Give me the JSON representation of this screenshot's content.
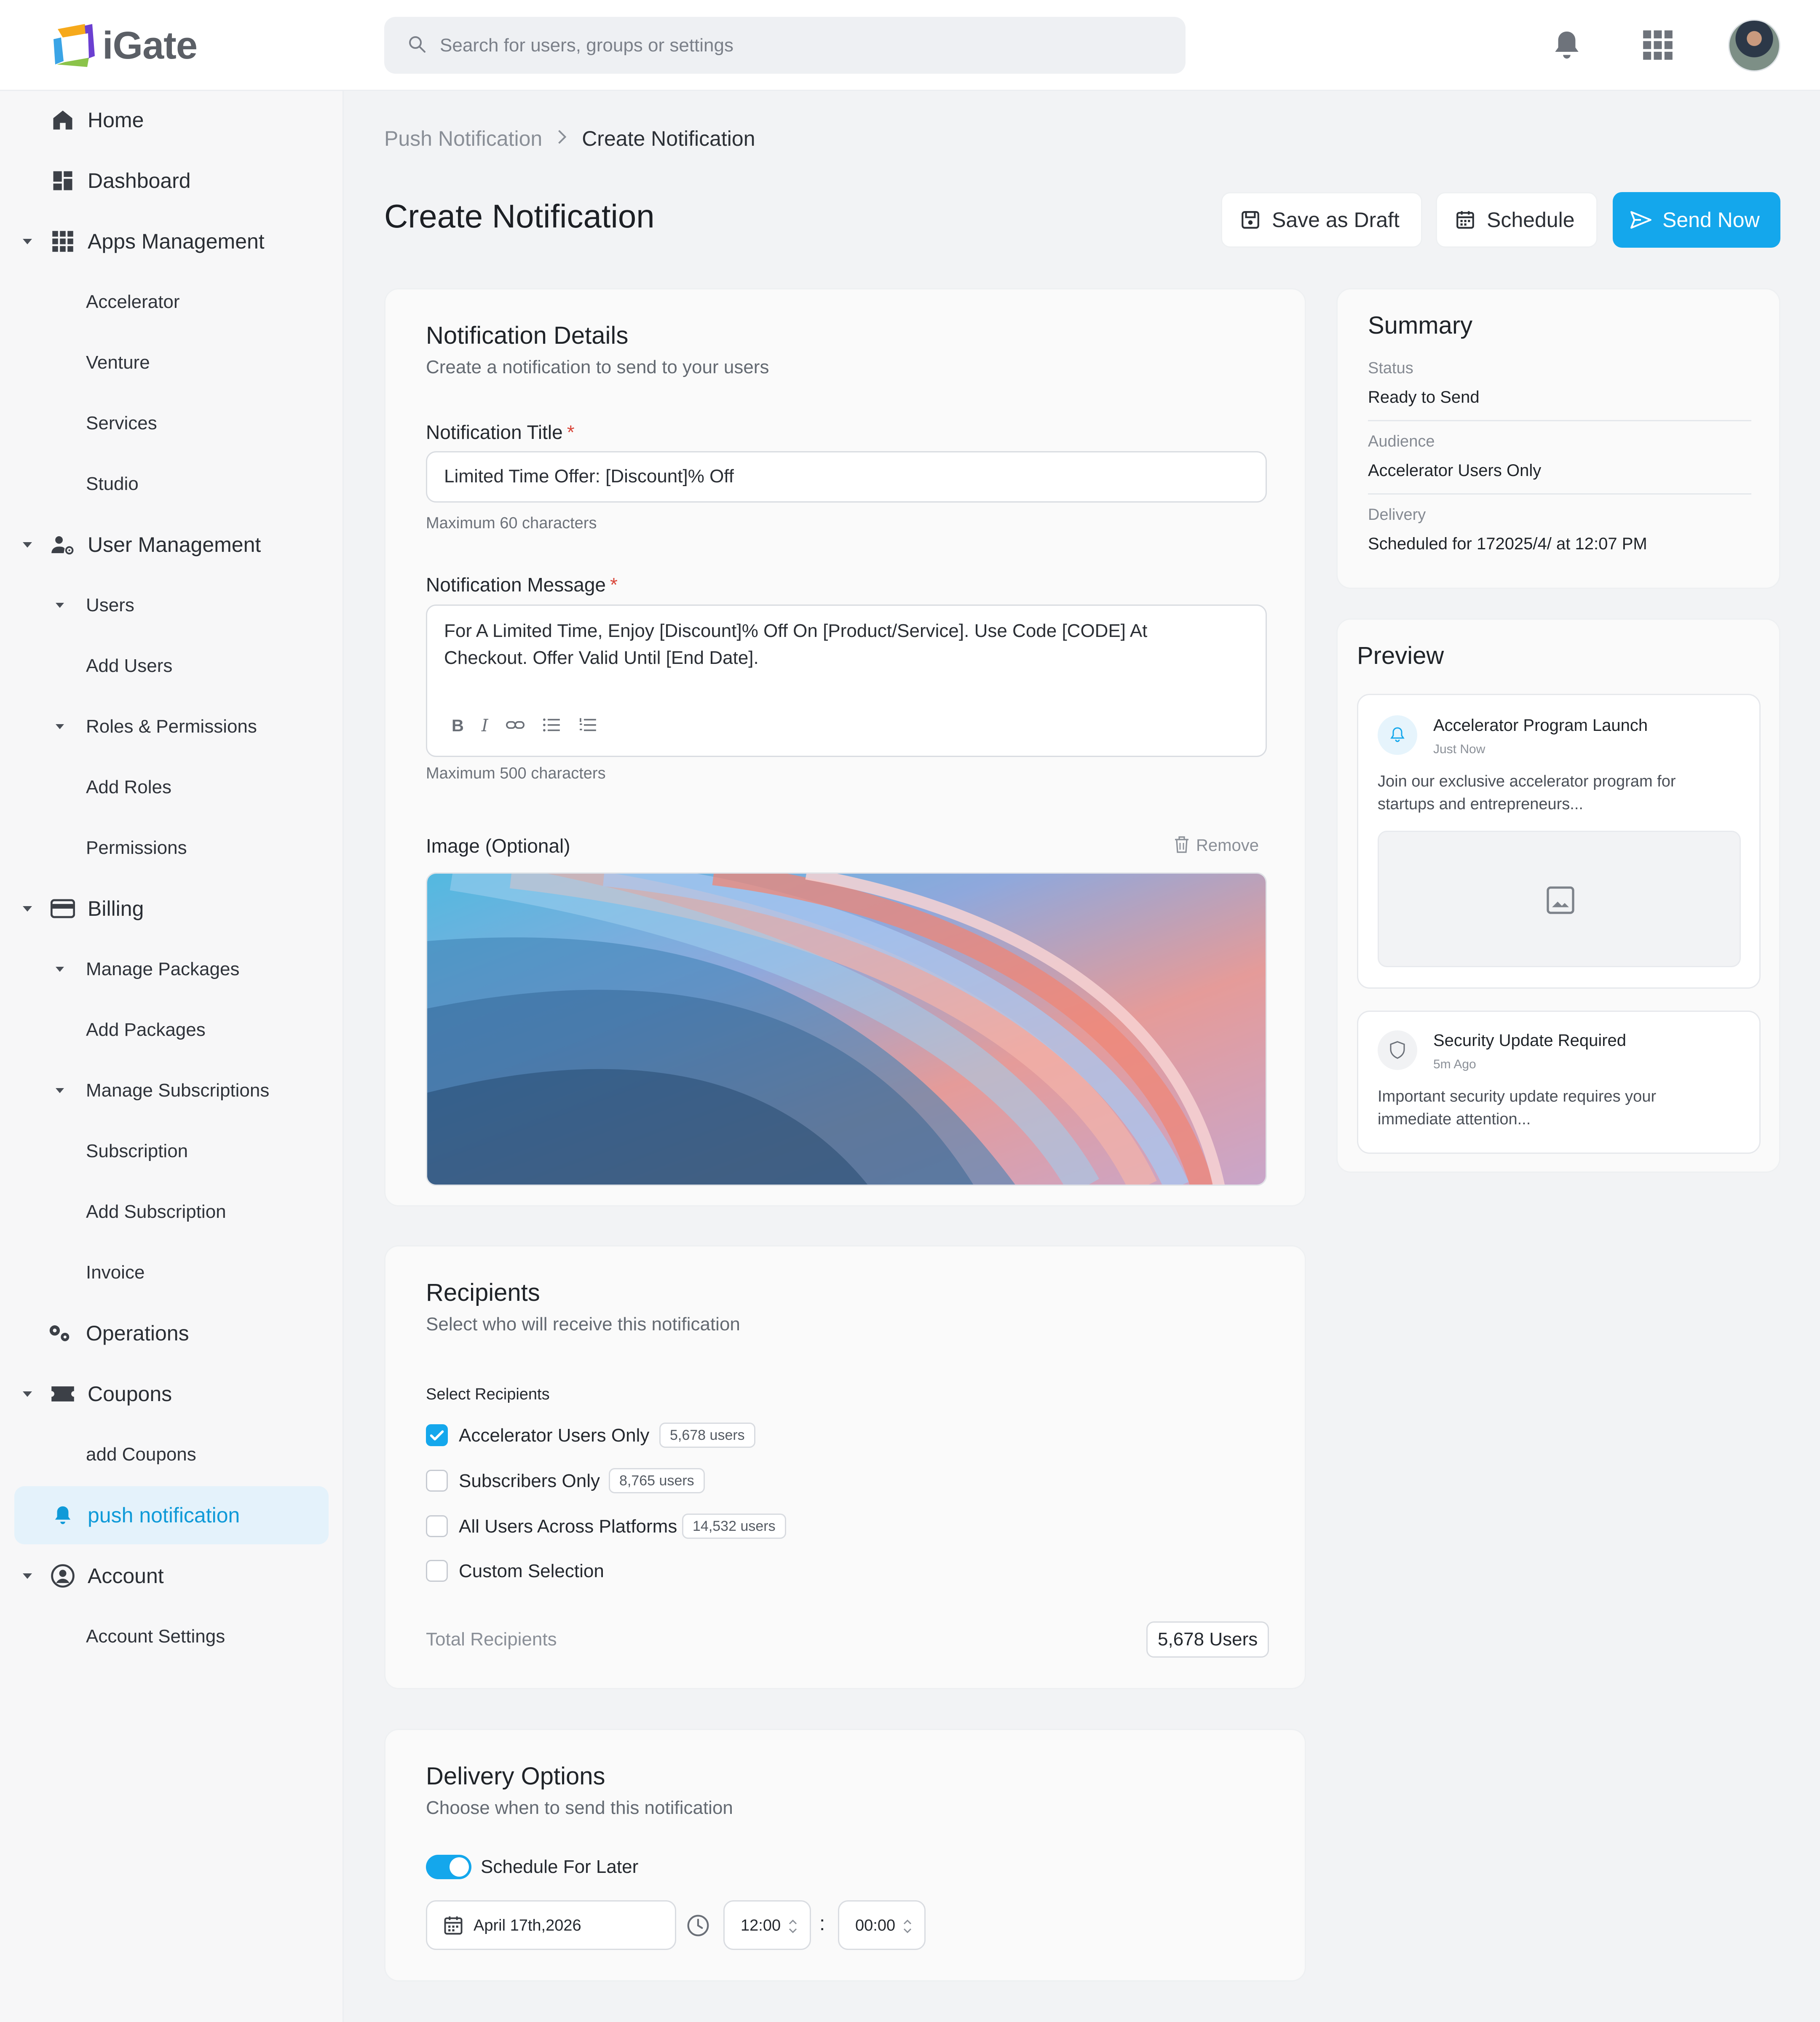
{
  "app": {
    "name": "iGate"
  },
  "search": {
    "placeholder": "Search for users, groups or settings"
  },
  "sidebar": {
    "items": [
      {
        "label": "Home"
      },
      {
        "label": "Dashboard"
      },
      {
        "label": "Apps Management"
      },
      {
        "label": "Accelerator"
      },
      {
        "label": "Venture"
      },
      {
        "label": "Services"
      },
      {
        "label": "Studio"
      },
      {
        "label": "User Management"
      },
      {
        "label": "Users"
      },
      {
        "label": "Add Users"
      },
      {
        "label": "Roles & Permissions"
      },
      {
        "label": "Add Roles"
      },
      {
        "label": "Permissions"
      },
      {
        "label": "Billing"
      },
      {
        "label": "Manage Packages"
      },
      {
        "label": "Add Packages"
      },
      {
        "label": "Manage Subscriptions"
      },
      {
        "label": "Subscription"
      },
      {
        "label": "Add Subscription"
      },
      {
        "label": "Invoice"
      },
      {
        "label": "Operations"
      },
      {
        "label": "Coupons"
      },
      {
        "label": "add Coupons"
      },
      {
        "label": "push notification"
      },
      {
        "label": "Account"
      },
      {
        "label": "Account Settings"
      }
    ],
    "active": "push notification"
  },
  "breadcrumb": {
    "parent": "Push Notification",
    "current": "Create Notification"
  },
  "header": {
    "title": "Create Notification",
    "save_draft": "Save as Draft",
    "schedule": "Schedule",
    "send_now": "Send Now"
  },
  "details": {
    "title": "Notification Details",
    "subtitle": "Create a notification to send to your users",
    "title_label": "Notification Title",
    "title_value": "Limited Time Offer: [Discount]% Off",
    "title_hint": "Maximum 60 characters",
    "message_label": "Notification Message",
    "message_line1": "For A Limited Time, Enjoy [Discount]% Off On [Product/Service]. Use Code [CODE] At",
    "message_line2": "Checkout. Offer Valid Until [End Date].",
    "message_hint": "Maximum 500 characters",
    "image_label": "Image (Optional)",
    "remove": "Remove",
    "required_mark": "*"
  },
  "recipients": {
    "title": "Recipients",
    "subtitle": "Select who will receive this notification",
    "select_label": "Select Recipients",
    "options": [
      {
        "label": "Accelerator Users Only",
        "count": "5,678 users",
        "checked": true
      },
      {
        "label": "Subscribers Only",
        "count": "8,765 users",
        "checked": false
      },
      {
        "label": "All Users Across Platforms",
        "count": "14,532 users",
        "checked": false
      },
      {
        "label": "Custom Selection",
        "count": "",
        "checked": false
      }
    ],
    "total_label": "Total Recipients",
    "total_value": "5,678 Users"
  },
  "delivery": {
    "title": "Delivery Options",
    "subtitle": "Choose when to send this notification",
    "toggle_label": "Schedule For Later",
    "toggle_on": true,
    "date": "April 17th,2026",
    "hour": "12:00",
    "minute": "00:00",
    "colon": ":"
  },
  "summary": {
    "title": "Summary",
    "status_label": "Status",
    "status_value": "Ready to Send",
    "audience_label": "Audience",
    "audience_value": "Accelerator Users Only",
    "delivery_label": "Delivery",
    "delivery_value": "Scheduled for 172025/4/ at 12:07 PM"
  },
  "preview": {
    "title": "Preview",
    "cards": [
      {
        "title": "Accelerator Program Launch",
        "time": "Just Now",
        "body_line1": "Join our exclusive accelerator program for",
        "body_line2": "startups and entrepreneurs..."
      },
      {
        "title": "Security Update Required",
        "time": "5m Ago",
        "body_line1": "Important security update requires your",
        "body_line2": "immediate attention..."
      }
    ]
  },
  "colors": {
    "accent": "#14a7ec",
    "required": "#d9473b",
    "active_bg": "#e4f2fb"
  }
}
